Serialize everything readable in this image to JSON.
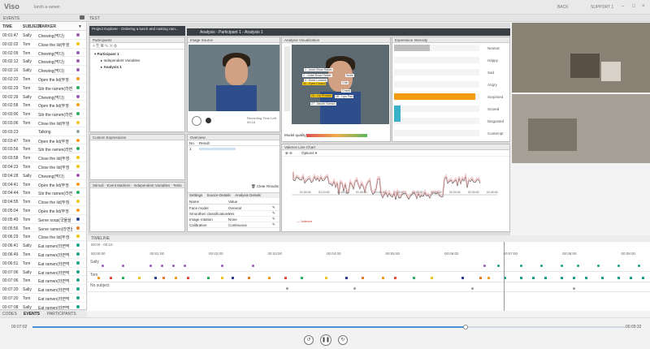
{
  "app": {
    "logo": "Viso",
    "subtitle": "lunch a ramen",
    "back": "BACK",
    "support": "SUPPORT 1"
  },
  "events_panel": {
    "label": "EVENTS",
    "test_label": "TEST",
    "columns": {
      "time": "TIME",
      "subject": "SUBJECT",
      "marker": "MARKER"
    },
    "rows": [
      {
        "time": "00:01:47",
        "subject": "Sally",
        "marker": "Chewing(먹다)",
        "color": "#9b59b6"
      },
      {
        "time": "00:02:02",
        "subject": "Tom",
        "marker": "Close the lid(뚜껑",
        "color": "#f1c40f"
      },
      {
        "time": "00:02:09",
        "subject": "Tom",
        "marker": "Chewing(먹다)",
        "color": "#9b59b6"
      },
      {
        "time": "00:02:12",
        "subject": "Sally",
        "marker": "Chewing(먹다)",
        "color": "#9b59b6"
      },
      {
        "time": "00:02:16",
        "subject": "Sally",
        "marker": "Chewing(먹다)",
        "color": "#9b59b6"
      },
      {
        "time": "00:02:22",
        "subject": "Tom",
        "marker": "Open the lid(뚜껑",
        "color": "#f39c12"
      },
      {
        "time": "00:02:29",
        "subject": "Tom",
        "marker": "Stir the ramen(라면",
        "color": "#27ae60"
      },
      {
        "time": "00:02:39",
        "subject": "Sally",
        "marker": "Chewing(먹다)",
        "color": "#9b59b6"
      },
      {
        "time": "00:02:58",
        "subject": "Tom",
        "marker": "Open the lid(뚜껑",
        "color": "#f39c12"
      },
      {
        "time": "00:03:00",
        "subject": "Tom",
        "marker": "Stir the ramen(라면",
        "color": "#27ae60"
      },
      {
        "time": "00:03:06",
        "subject": "Tom",
        "marker": "Close the lid(뚜껑",
        "color": "#f1c40f"
      },
      {
        "time": "00:03:23",
        "subject": "",
        "marker": "Talking",
        "color": "#95a5a6"
      },
      {
        "time": "00:03:47",
        "subject": "Tom",
        "marker": "Open the lid(뚜껑",
        "color": "#f39c12"
      },
      {
        "time": "00:03:56",
        "subject": "Tom",
        "marker": "Stir the ramen(라면",
        "color": "#27ae60"
      },
      {
        "time": "00:03:58",
        "subject": "Tom",
        "marker": "Close the lid(뚜껑",
        "color": "#f1c40f"
      },
      {
        "time": "00:04:23",
        "subject": "Tom",
        "marker": "Close the lid(뚜껑",
        "color": "#f1c40f"
      },
      {
        "time": "00:04:28",
        "subject": "Sally",
        "marker": "Chewing(먹다)",
        "color": "#9b59b6"
      },
      {
        "time": "00:04:41",
        "subject": "Tom",
        "marker": "Open the lid(뚜껑",
        "color": "#f39c12"
      },
      {
        "time": "00:04:44",
        "subject": "Tom",
        "marker": "Stir the ramen(라면",
        "color": "#27ae60"
      },
      {
        "time": "00:04:55",
        "subject": "Tom",
        "marker": "Close the lid(뚜껑",
        "color": "#f1c40f"
      },
      {
        "time": "00:05:04",
        "subject": "Tom",
        "marker": "Open the lid(뚜껑",
        "color": "#f39c12"
      },
      {
        "time": "00:05:49",
        "subject": "Tom",
        "marker": "Serve soup(국물을",
        "color": "#2c3e90"
      },
      {
        "time": "00:05:56",
        "subject": "Tom",
        "marker": "Serve ramen(라면을",
        "color": "#e67e22"
      },
      {
        "time": "00:06:29",
        "subject": "Tom",
        "marker": "Close the lid(뚜껑",
        "color": "#f1c40f"
      },
      {
        "time": "00:06:41",
        "subject": "Sally",
        "marker": "Eat ramen(라면먹",
        "color": "#16a085"
      },
      {
        "time": "00:06:49",
        "subject": "Tom",
        "marker": "Eat ramen(라면먹",
        "color": "#16a085"
      },
      {
        "time": "00:06:51",
        "subject": "Tom",
        "marker": "Eat ramen(라면먹",
        "color": "#16a085"
      },
      {
        "time": "00:07:06",
        "subject": "Sally",
        "marker": "Eat ramen(라면먹",
        "color": "#16a085"
      },
      {
        "time": "00:07:06",
        "subject": "Tom",
        "marker": "Eat ramen(라면먹",
        "color": "#16a085"
      },
      {
        "time": "00:07:20",
        "subject": "Sally",
        "marker": "Eat ramen(라면먹",
        "color": "#16a085"
      },
      {
        "time": "00:07:20",
        "subject": "Tom",
        "marker": "Eat ramen(라면먹",
        "color": "#16a085"
      },
      {
        "time": "00:07:08",
        "subject": "Sally",
        "marker": "Eat ramen(라면먹",
        "color": "#16a085"
      }
    ],
    "bottom_tabs": [
      "CODES",
      "EVENTS",
      "PARTICIPANTS"
    ]
  },
  "project": {
    "title": "Project Explorer - Ordering a lunch and making ram...",
    "participants_label": "Participants",
    "participant1": "Participant 1",
    "independent": "Independent Variables",
    "analysis1": "Analysis 1",
    "custom_expr": "Custom Expressions",
    "stim_tabs": [
      "Stimuli",
      "Event Markers",
      "Independent Variables",
      "Tests"
    ]
  },
  "analysis_window": {
    "title": "Analysis - Participant 1 - Analysis 1"
  },
  "image_source": {
    "label": "Image Source",
    "remaining": "Recording Time Left: 00:18"
  },
  "overview": {
    "label": "Overview",
    "no_col": "No.",
    "result_col": "Result",
    "row_no": "1",
    "clear": "Clear Results"
  },
  "settings": {
    "tabs": [
      "Settings",
      "Source Details",
      "Analysis Details"
    ],
    "name_col": "Name",
    "value_col": "Value",
    "rows": [
      {
        "name": "Face model",
        "value": "General"
      },
      {
        "name": "Smoothen classifications",
        "value": "Yes"
      },
      {
        "name": "Image rotation",
        "value": "None"
      },
      {
        "name": "Calibration",
        "value": "Continuous"
      }
    ]
  },
  "viz": {
    "label": "Analysis Visualization",
    "model_quality": "Model quality",
    "landmarks": [
      "1 - Inner Brow Raiser",
      "2 - Outer Brow Raiser",
      "4 - Brow Lowerer",
      "43 - Eyes Closed",
      "24 - Lip Presser",
      "27 - Mouth Stretch",
      "Smile",
      "Chin",
      "Cheek",
      "28 - Lips Part"
    ]
  },
  "expression": {
    "label": "Expression Intensity",
    "items": [
      {
        "name": "Neutral",
        "value": 0.42
      },
      {
        "name": "Happy",
        "value": 0.0
      },
      {
        "name": "Sad",
        "value": 0.0
      },
      {
        "name": "Angry",
        "value": 0.0
      },
      {
        "name": "Surprised",
        "value": 0.95
      },
      {
        "name": "Scared",
        "value": 0.0
      },
      {
        "name": "Disgusted",
        "value": 0.0
      },
      {
        "name": "Contempt",
        "value": 0.0
      }
    ]
  },
  "line_chart": {
    "label": "Valence Line Chart",
    "options": "Options",
    "legend": "Valence",
    "xticks": [
      "01:00:00",
      "01:10:00",
      "01:20:00",
      "01:30:00",
      "01:40:00",
      "01:50:00",
      "02:00:00",
      "02:10:00",
      "02:20:00",
      "02:30:00",
      "02:40:00"
    ]
  },
  "timeline": {
    "label": "TIMELINE",
    "range": "00:00 - 00:10",
    "ticks": [
      "00:00:00",
      "00:01:00",
      "00:02:00",
      "00:03:00",
      "00:04:00",
      "00:05:00",
      "00:06:00",
      "00:07:00",
      "00:08:00",
      "00:09:00"
    ],
    "lanes": [
      "Sally",
      "Tom",
      "No subject"
    ]
  },
  "player": {
    "current": "00:07:02",
    "total": "00:09:32",
    "progress": 0.73
  }
}
